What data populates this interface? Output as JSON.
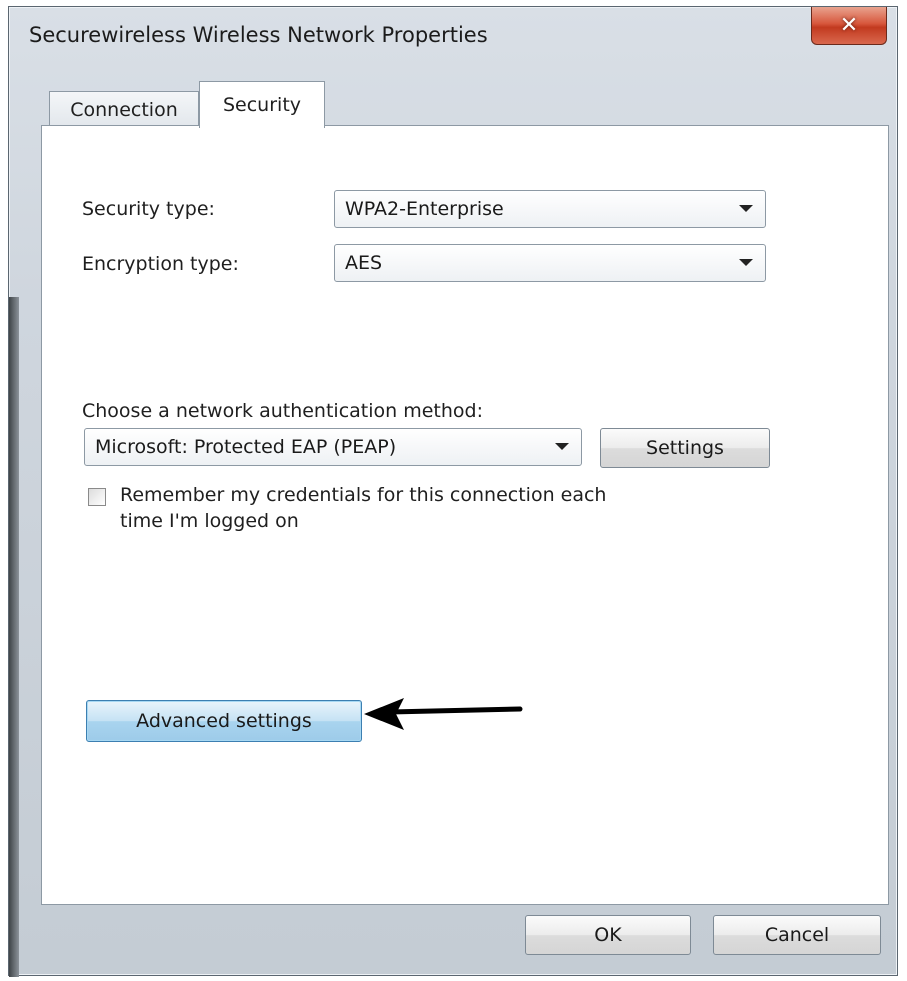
{
  "window": {
    "title": "Securewireless Wireless Network Properties",
    "close_glyph": "✕"
  },
  "tabs": [
    {
      "label": "Connection",
      "active": false
    },
    {
      "label": "Security",
      "active": true
    }
  ],
  "security": {
    "security_type_label": "Security type:",
    "security_type_value": "WPA2-Enterprise",
    "encryption_type_label": "Encryption type:",
    "encryption_type_value": "AES",
    "auth_method_label": "Choose a network authentication method:",
    "auth_method_value": "Microsoft: Protected EAP (PEAP)",
    "settings_button": "Settings",
    "remember_line1": "Remember my credentials for this connection each",
    "remember_line2": "time I'm logged on",
    "remember_checked": false,
    "advanced_button": "Advanced settings"
  },
  "footer": {
    "ok_label": "OK",
    "cancel_label": "Cancel"
  },
  "icons": {
    "close": "close-icon",
    "dropdown": "chevron-down-icon",
    "annotation": "arrow-left-icon"
  }
}
